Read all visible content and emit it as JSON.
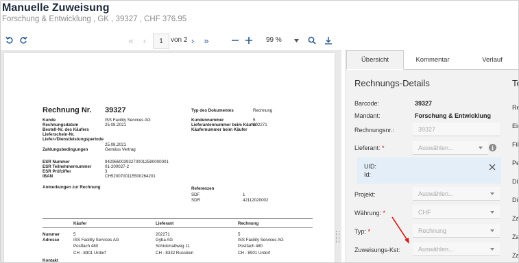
{
  "header": {
    "title": "Manuelle Zuweisung",
    "subtitle": "Forschung & Entwicklung , GK , 39327 , CHF 376.95"
  },
  "toolbar": {
    "page_value": "1",
    "page_of": "von 2",
    "zoom": "99 %"
  },
  "document": {
    "invoice_label": "Rechnung Nr.",
    "invoice_number": "39327",
    "doctype_label": "Typ des Dokumentes",
    "doctype_value": "Rechnung",
    "left_labels": [
      "Kunde",
      "Rechnungsdatum",
      "Bestell-Nr. des Käufers",
      "Lieferschein-Nr.",
      "Liefer-/Dienstleistungsperiode"
    ],
    "left_values": [
      "ISS Facility Services AG",
      "25.08.2021"
    ],
    "right_labels": [
      "Kundennummer",
      "Lieferantennummer beim Käufer",
      "Käufernummer beim Käufer"
    ],
    "right_values": [
      "5",
      "202271"
    ],
    "period_value": "25.08.2021",
    "payment_label": "Zahlungsbedingungen",
    "payment_value": "Gemäss Vertrag",
    "esr_labels": [
      "ESR Nummer",
      "ESR Teilnehmernummer",
      "ESR Prüfziffer",
      "IBAN"
    ],
    "esr_values": [
      "942966003932700012590000001",
      "01-200027-2",
      "3",
      "CH5200700115500264201"
    ],
    "remarks_label": "Anmerkungen zur Rechnung",
    "references_label": "Referenzen",
    "ref_labels": [
      "SDF",
      "SDR"
    ],
    "ref_values": [
      "1",
      "42112020002"
    ],
    "table_headers": [
      "Käufer",
      "Lieferant",
      "Rechnung"
    ],
    "row_labels": [
      "Nummer",
      "Adresse",
      "",
      "",
      "Kontakt"
    ],
    "buyer": [
      "5",
      "ISS Facility Services AG",
      "Postfach 480",
      "CH - 8901 Urdorf"
    ],
    "supplier": [
      "202271",
      "Gyba AG",
      "Schickmattweg 11",
      "CH - 8332 Russikon"
    ],
    "invoice_party": [
      "5",
      "ISS Facility Services AG",
      "Postfach 480",
      "CH - 8901 Urdorf"
    ]
  },
  "tabs": [
    "Übersicht",
    "Kommentar",
    "Verlauf"
  ],
  "details": {
    "section_title": "Rechnungs-Details",
    "section_title_right": "Te",
    "barcode_label": "Barcode:",
    "barcode_value": "39327",
    "mandant_label": "Mandant:",
    "mandant_value": "Forschung & Entwicklung",
    "rechnungsnr_label": "Rechnungsnr.:",
    "rechnungsnr_value": "39327",
    "lieferant_label": "Lieferant:",
    "lieferant_placeholder": "Auswählen...",
    "uid_label": "UID:",
    "id_label": "Id:",
    "projekt_label": "Projekt:",
    "projekt_placeholder": "Auswählen...",
    "waehrung_label": "Währung:",
    "waehrung_value": "CHF",
    "typ_label": "Typ:",
    "typ_value": "Rechnung",
    "zkst_label": "Zuweisungs-Kst:",
    "zkst_placeholder": "Auswählen...",
    "required_mark": "*",
    "right_col": [
      "Re",
      "Ein",
      "Fib",
      "Pe",
      "Di",
      "Di",
      "Za",
      "Za",
      "Za"
    ]
  },
  "colors": {
    "accent": "#2a5a8f",
    "required": "#cc0000",
    "arrow": "#d0201a",
    "uid_bg": "#e3eef8"
  }
}
